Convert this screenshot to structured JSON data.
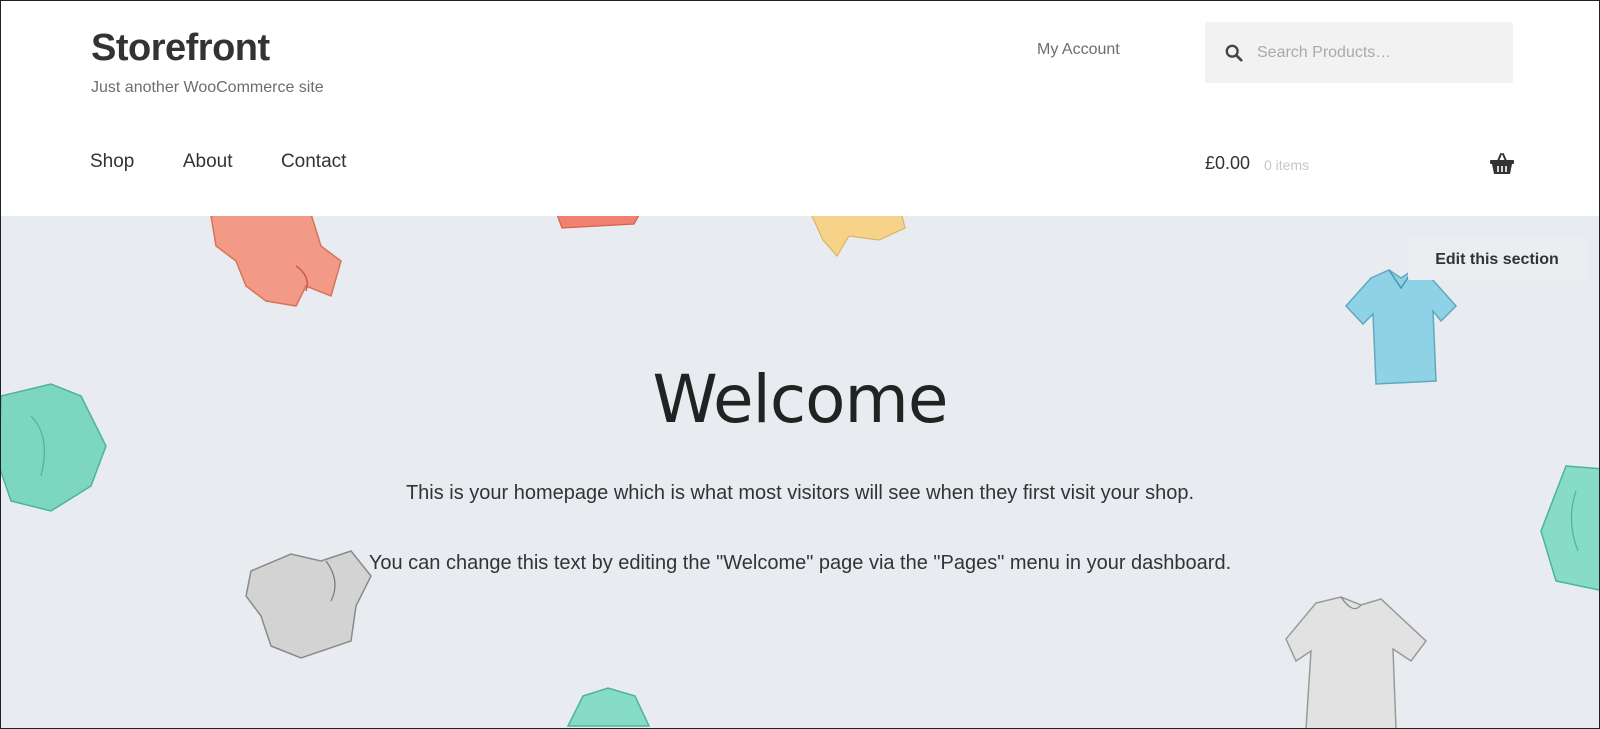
{
  "site": {
    "title": "Storefront",
    "tagline": "Just another WooCommerce site"
  },
  "header": {
    "account_link": "My Account",
    "search": {
      "placeholder": "Search Products…",
      "value": ""
    }
  },
  "nav": {
    "items": [
      {
        "label": "Shop"
      },
      {
        "label": "About"
      },
      {
        "label": "Contact"
      }
    ]
  },
  "cart": {
    "total": "£0.00",
    "count": "0 items"
  },
  "hero": {
    "edit_label": "Edit this section",
    "heading": "Welcome",
    "paragraph1": "This is your homepage which is what most visitors will see when they first visit your shop.",
    "paragraph2": "You can change this text by editing the \"Welcome\" page via the \"Pages\" menu in your dashboard."
  },
  "colors": {
    "hero_background": "#e8ecf0",
    "text": "#333333",
    "muted": "#6d6d6d",
    "search_background": "#f2f2f2"
  },
  "icons": [
    "search-icon",
    "basket-icon"
  ]
}
